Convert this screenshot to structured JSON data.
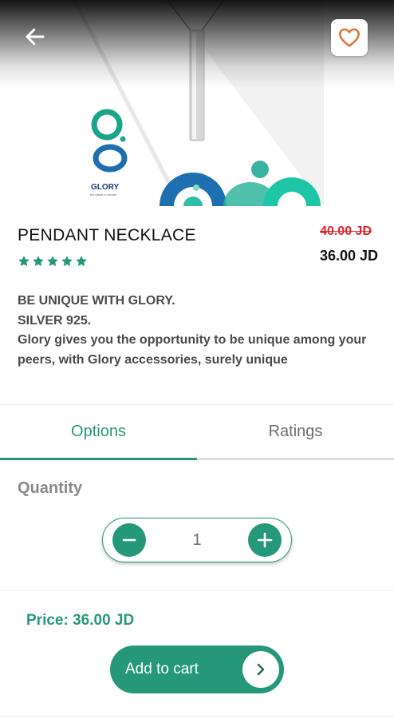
{
  "product": {
    "title": "PENDANT NECKLACE",
    "old_price": "40.00 JD",
    "price": "36.00 JD",
    "rating": 5,
    "rating_max": 5,
    "description": [
      "BE UNIQUE WITH GLORY.",
      "SILVER 925.",
      "Glory gives you the opportunity to be unique among your peers, with Glory accessories, surely unique"
    ],
    "image": {
      "brand_name": "GLORY",
      "brand_tagline": "the place to dream"
    }
  },
  "header": {
    "back_icon": "arrow-left-icon",
    "favorite_icon": "heart-outline-icon"
  },
  "tabs": [
    {
      "label": "Options",
      "active": true
    },
    {
      "label": "Ratings",
      "active": false
    }
  ],
  "options": {
    "quantity_label": "Quantity",
    "quantity_value": "1",
    "minus_icon": "minus-icon",
    "plus_icon": "plus-icon"
  },
  "footer": {
    "price_text": "Price: 36.00 JD",
    "add_to_cart_label": "Add to cart",
    "cart_arrow_icon": "chevron-right-icon"
  },
  "colors": {
    "accent": "#26987a",
    "strike_price": "#e0242c",
    "favorite_icon": "#e0763a"
  }
}
